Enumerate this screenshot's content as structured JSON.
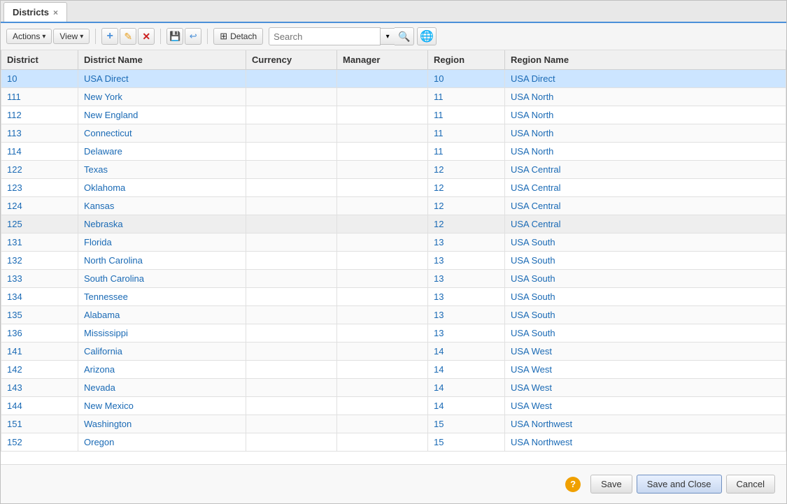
{
  "window": {
    "title": "Districts",
    "tab_close": "×"
  },
  "toolbar": {
    "actions_label": "Actions",
    "view_label": "View",
    "detach_label": "Detach",
    "search_placeholder": "Search",
    "search_label": "Search"
  },
  "table": {
    "columns": [
      {
        "key": "district",
        "label": "District"
      },
      {
        "key": "district_name",
        "label": "District Name"
      },
      {
        "key": "currency",
        "label": "Currency"
      },
      {
        "key": "manager",
        "label": "Manager"
      },
      {
        "key": "region",
        "label": "Region"
      },
      {
        "key": "region_name",
        "label": "Region Name"
      }
    ],
    "rows": [
      {
        "district": "10",
        "district_name": "USA Direct",
        "currency": "",
        "manager": "",
        "region": "10",
        "region_name": "USA Direct",
        "selected": true
      },
      {
        "district": "111",
        "district_name": "New York",
        "currency": "",
        "manager": "",
        "region": "11",
        "region_name": "USA North",
        "selected": false
      },
      {
        "district": "112",
        "district_name": "New England",
        "currency": "",
        "manager": "",
        "region": "11",
        "region_name": "USA North",
        "selected": false
      },
      {
        "district": "113",
        "district_name": "Connecticut",
        "currency": "",
        "manager": "",
        "region": "11",
        "region_name": "USA North",
        "selected": false
      },
      {
        "district": "114",
        "district_name": "Delaware",
        "currency": "",
        "manager": "",
        "region": "11",
        "region_name": "USA North",
        "selected": false
      },
      {
        "district": "122",
        "district_name": "Texas",
        "currency": "",
        "manager": "",
        "region": "12",
        "region_name": "USA Central",
        "selected": false
      },
      {
        "district": "123",
        "district_name": "Oklahoma",
        "currency": "",
        "manager": "",
        "region": "12",
        "region_name": "USA Central",
        "selected": false
      },
      {
        "district": "124",
        "district_name": "Kansas",
        "currency": "",
        "manager": "",
        "region": "12",
        "region_name": "USA Central",
        "selected": false
      },
      {
        "district": "125",
        "district_name": "Nebraska",
        "currency": "",
        "manager": "",
        "region": "12",
        "region_name": "USA Central",
        "selected": false,
        "striped": true
      },
      {
        "district": "131",
        "district_name": "Florida",
        "currency": "",
        "manager": "",
        "region": "13",
        "region_name": "USA South",
        "selected": false
      },
      {
        "district": "132",
        "district_name": "North Carolina",
        "currency": "",
        "manager": "",
        "region": "13",
        "region_name": "USA South",
        "selected": false
      },
      {
        "district": "133",
        "district_name": "South Carolina",
        "currency": "",
        "manager": "",
        "region": "13",
        "region_name": "USA South",
        "selected": false
      },
      {
        "district": "134",
        "district_name": "Tennessee",
        "currency": "",
        "manager": "",
        "region": "13",
        "region_name": "USA South",
        "selected": false
      },
      {
        "district": "135",
        "district_name": "Alabama",
        "currency": "",
        "manager": "",
        "region": "13",
        "region_name": "USA South",
        "selected": false
      },
      {
        "district": "136",
        "district_name": "Mississippi",
        "currency": "",
        "manager": "",
        "region": "13",
        "region_name": "USA South",
        "selected": false
      },
      {
        "district": "141",
        "district_name": "California",
        "currency": "",
        "manager": "",
        "region": "14",
        "region_name": "USA West",
        "selected": false
      },
      {
        "district": "142",
        "district_name": "Arizona",
        "currency": "",
        "manager": "",
        "region": "14",
        "region_name": "USA West",
        "selected": false
      },
      {
        "district": "143",
        "district_name": "Nevada",
        "currency": "",
        "manager": "",
        "region": "14",
        "region_name": "USA West",
        "selected": false
      },
      {
        "district": "144",
        "district_name": "New Mexico",
        "currency": "",
        "manager": "",
        "region": "14",
        "region_name": "USA West",
        "selected": false
      },
      {
        "district": "151",
        "district_name": "Washington",
        "currency": "",
        "manager": "",
        "region": "15",
        "region_name": "USA Northwest",
        "selected": false
      },
      {
        "district": "152",
        "district_name": "Oregon",
        "currency": "",
        "manager": "",
        "region": "15",
        "region_name": "USA Northwest",
        "selected": false
      }
    ]
  },
  "footer": {
    "help_label": "?",
    "save_label": "Save",
    "save_close_label": "Save and Close",
    "cancel_label": "Cancel"
  },
  "icons": {
    "add": "+",
    "edit": "✏",
    "delete": "✕",
    "save_row": "💾",
    "detach": "⊞",
    "search": "🔍",
    "globe": "🌐",
    "chevron_down": "▾",
    "help": "?"
  }
}
